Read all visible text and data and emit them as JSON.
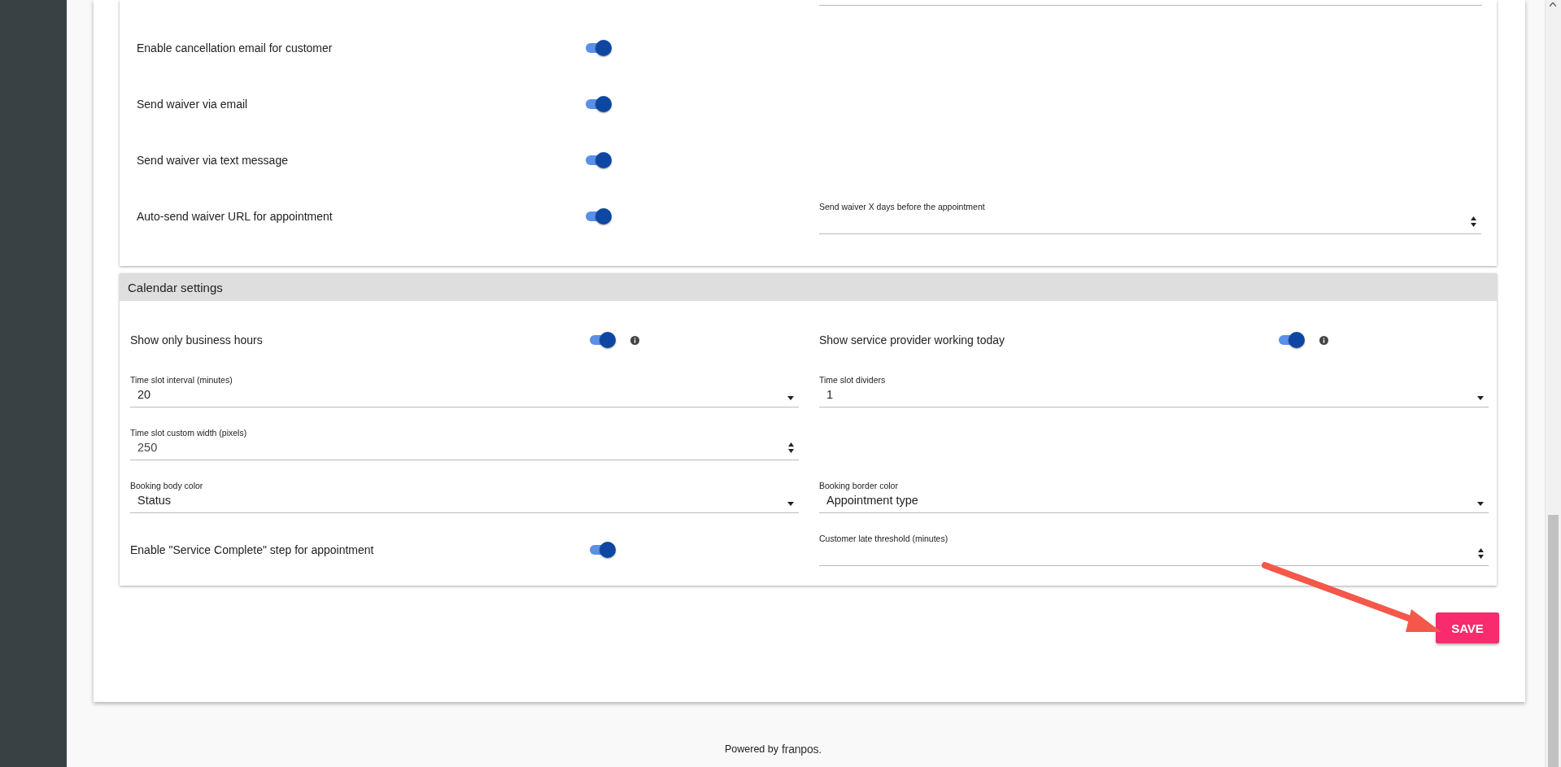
{
  "notification_settings": {
    "rows": [
      {
        "label": "Enable cancellation email for customer",
        "on": true
      },
      {
        "label": "Send waiver via email",
        "on": true
      },
      {
        "label": "Send waiver via text message",
        "on": true
      },
      {
        "label": "Auto-send waiver URL for appointment",
        "on": true,
        "field": {
          "kind": "number",
          "label": "Send waiver X days before the appointment"
        }
      }
    ]
  },
  "calendar_settings": {
    "title": "Calendar settings",
    "rows": [
      [
        {
          "kind": "toggle",
          "label": "Show only business hours",
          "on": true,
          "info": true
        },
        {
          "kind": "toggle",
          "label": "Show service provider working today",
          "on": true,
          "info": true
        }
      ],
      [
        {
          "kind": "select",
          "label": "Time slot interval (minutes)",
          "value": "20"
        },
        {
          "kind": "select",
          "label": "Time slot dividers",
          "value": "1"
        }
      ],
      [
        {
          "kind": "number",
          "label": "Time slot custom width (pixels)",
          "value": "250"
        }
      ],
      [
        {
          "kind": "select",
          "label": "Booking body color",
          "value": "Status"
        },
        {
          "kind": "select",
          "label": "Booking border color",
          "value": "Appointment type"
        }
      ],
      [
        {
          "kind": "toggle",
          "label": "Enable \"Service Complete\" step for appointment",
          "on": true,
          "info": false
        },
        {
          "kind": "number",
          "label": "Customer late threshold (minutes)"
        }
      ]
    ]
  },
  "save_button": "SAVE",
  "footer": {
    "text": "Powered by",
    "brand": "franpos."
  }
}
